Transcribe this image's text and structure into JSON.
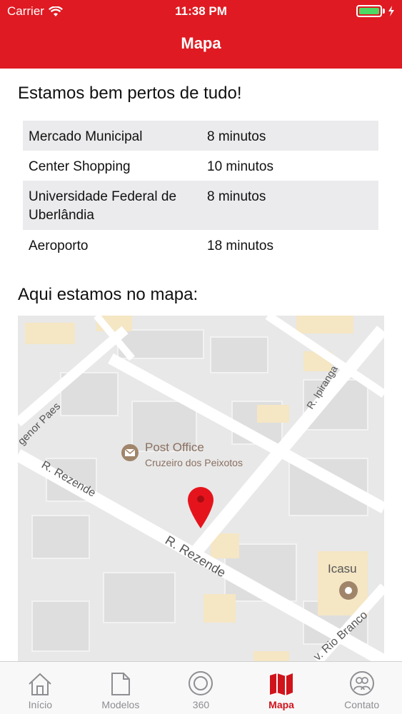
{
  "status_bar": {
    "carrier": "Carrier",
    "time": "11:38 PM",
    "wifi_icon": "wifi-icon",
    "battery_icon": "battery-icon"
  },
  "header": {
    "title": "Mapa",
    "background": "#df1a22"
  },
  "nearby": {
    "heading": "Estamos bem pertos de tudo!",
    "rows": [
      {
        "place": "Mercado Municipal",
        "time": "8 minutos"
      },
      {
        "place": "Center Shopping",
        "time": "10 minutos"
      },
      {
        "place": "Universidade Federal de Uberlândia",
        "time": "8 minutos"
      },
      {
        "place": "Aeroporto",
        "time": "18 minutos"
      }
    ]
  },
  "map_section": {
    "heading": "Aqui estamos no mapa:",
    "labels": {
      "post_office": "Post Office",
      "post_office_sub": "Cruzeiro dos Peixotos",
      "street_rezende_1": "R. Rezende",
      "street_rezende_2": "R. Rezende",
      "street_ipiranga": "R. Ipiranga",
      "street_agenor": "genor Paes",
      "street_rio_branco": "v. Rio Branco",
      "poi_icasu": "Icasu"
    },
    "pin_color": "#e5141c"
  },
  "tabbar": {
    "active_color": "#d0141b",
    "tabs": [
      {
        "label": "Início",
        "icon": "home-icon",
        "active": false
      },
      {
        "label": "Modelos",
        "icon": "document-icon",
        "active": false
      },
      {
        "label": "360",
        "icon": "360-ring-icon",
        "active": false
      },
      {
        "label": "Mapa",
        "icon": "map-icon",
        "active": true
      },
      {
        "label": "Contato",
        "icon": "contacts-icon",
        "active": false
      }
    ]
  }
}
